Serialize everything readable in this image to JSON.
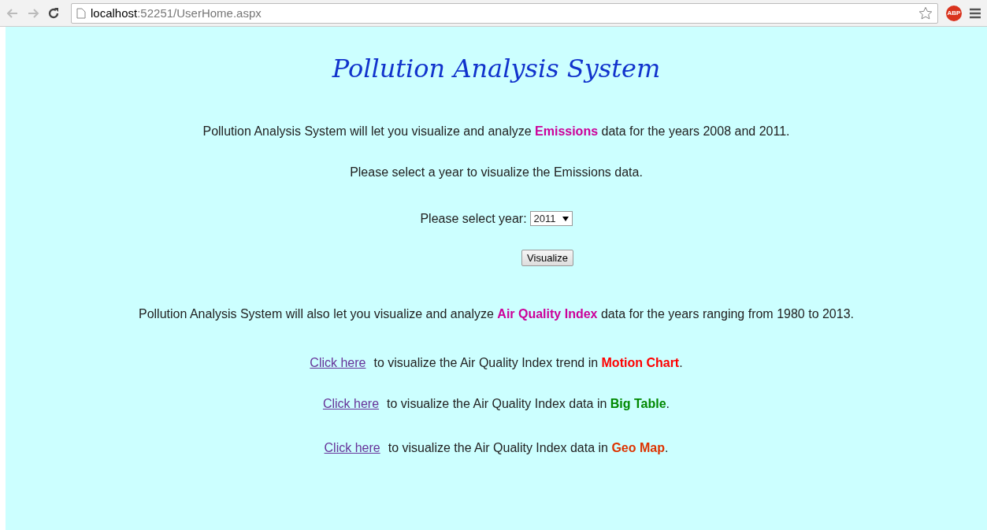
{
  "browser": {
    "url_host": "localhost",
    "url_rest": ":52251/UserHome.aspx",
    "abp_badge": "ABP"
  },
  "title": "Pollution Analysis System",
  "intro": {
    "before": "Pollution Analysis System will let you visualize and analyze ",
    "highlight": "Emissions",
    "color": "#cc0099",
    "after": " data for the years 2008 and 2011."
  },
  "prompt": "Please select a year to visualize the Emissions data.",
  "year_select": {
    "label": "Please select year:",
    "value": "2011"
  },
  "visualize_button": "Visualize",
  "aqi_intro": {
    "before": "Pollution Analysis System will also let you visualize and analyze ",
    "highlight": "Air Quality Index",
    "color": "#cc0099",
    "after": " data for the years ranging from 1980 to 2013."
  },
  "links": [
    {
      "link": "Click here",
      "before": "to visualize the Air Quality Index trend in ",
      "highlight": "Motion Chart",
      "color": "#ff0000",
      "after": "."
    },
    {
      "link": "Click here",
      "before": "to visualize the Air Quality Index data in ",
      "highlight": "Big Table",
      "color": "#008800",
      "after": "."
    },
    {
      "link": "Click here",
      "before": "to visualize the Air Quality Index data in ",
      "highlight": "Geo Map",
      "color": "#dd3300",
      "after": "."
    }
  ]
}
